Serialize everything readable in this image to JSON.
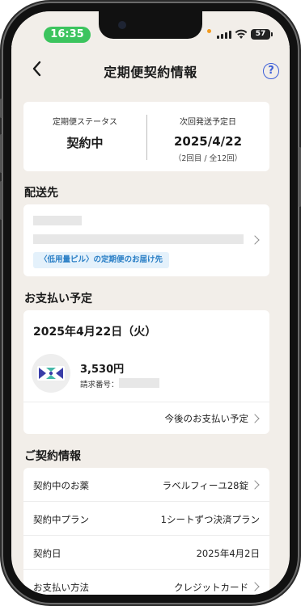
{
  "status_bar": {
    "time": "16:35",
    "battery": "57"
  },
  "nav": {
    "title": "定期便契約情報",
    "help": "?"
  },
  "subscription": {
    "status_label": "定期便ステータス",
    "status_value": "契約中",
    "next_label": "次回発送予定日",
    "next_date": "2025/4/22",
    "next_count": "（2回目 / 全12回）"
  },
  "delivery": {
    "section_title": "配送先",
    "tag": "〈低用量ピル〉の定期便のお届け先"
  },
  "payment": {
    "section_title": "お支払い予定",
    "date": "2025年4月22日（火）",
    "amount": "3,530円",
    "bill_label": "請求番号：",
    "future_link": "今後のお支払い予定"
  },
  "contract": {
    "section_title": "ご契約情報",
    "rows": [
      {
        "label": "契約中のお薬",
        "value": "ラベルフィーユ28錠"
      },
      {
        "label": "契約中プラン",
        "value": "1シートずつ決済プラン"
      },
      {
        "label": "契約日",
        "value": "2025年4月2日"
      },
      {
        "label": "お支払い方法",
        "value": "クレジットカード"
      }
    ]
  },
  "colors": {
    "accent_blue": "#3d5fd8",
    "time_pill": "#3cc45e",
    "tag_bg": "#e4f1fb",
    "tag_text": "#2a7fc6",
    "background": "#f2eee9"
  }
}
